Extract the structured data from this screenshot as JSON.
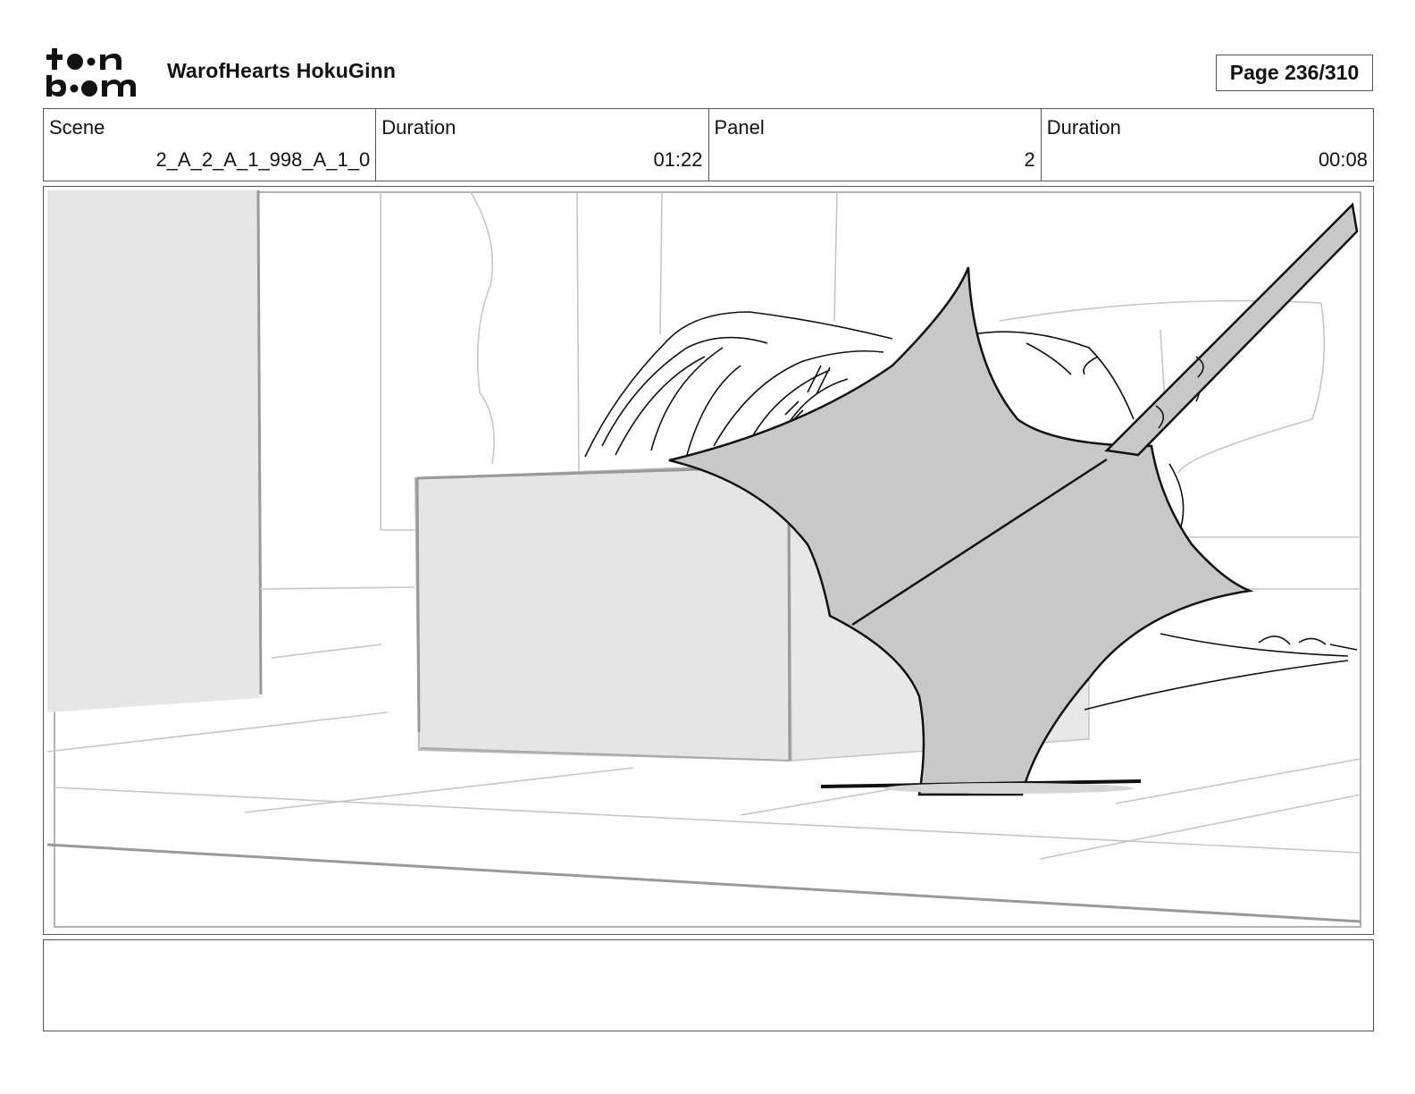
{
  "header": {
    "logo_text": "toon boom",
    "project_title": "WarofHearts HokuGinn",
    "page_label": "Page 236/310"
  },
  "info": {
    "scene": {
      "label": "Scene",
      "value": "2_A_2_A_1_998_A_1_0"
    },
    "scene_duration": {
      "label": "Duration",
      "value": "01:22"
    },
    "panel": {
      "label": "Panel",
      "value": "2"
    },
    "panel_duration": {
      "label": "Duration",
      "value": "00:08"
    }
  },
  "notes": {
    "text": ""
  }
}
